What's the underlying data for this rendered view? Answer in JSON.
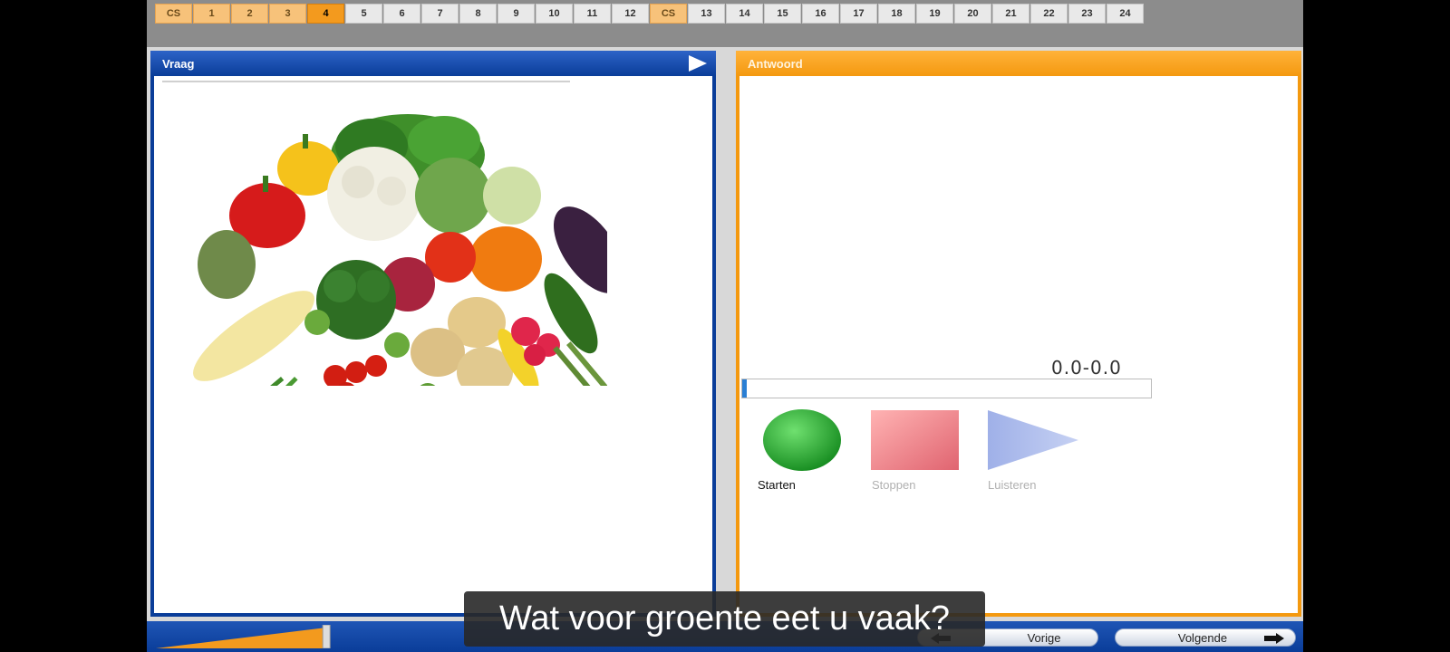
{
  "question_bar": {
    "items": [
      {
        "label": "CS",
        "state": "done"
      },
      {
        "label": "1",
        "state": "done"
      },
      {
        "label": "2",
        "state": "done"
      },
      {
        "label": "3",
        "state": "done"
      },
      {
        "label": "4",
        "state": "current"
      },
      {
        "label": "5",
        "state": "todo"
      },
      {
        "label": "6",
        "state": "todo"
      },
      {
        "label": "7",
        "state": "todo"
      },
      {
        "label": "8",
        "state": "todo"
      },
      {
        "label": "9",
        "state": "todo"
      },
      {
        "label": "10",
        "state": "todo"
      },
      {
        "label": "11",
        "state": "todo"
      },
      {
        "label": "12",
        "state": "todo"
      },
      {
        "label": "CS",
        "state": "done"
      },
      {
        "label": "13",
        "state": "todo"
      },
      {
        "label": "14",
        "state": "todo"
      },
      {
        "label": "15",
        "state": "todo"
      },
      {
        "label": "16",
        "state": "todo"
      },
      {
        "label": "17",
        "state": "todo"
      },
      {
        "label": "18",
        "state": "todo"
      },
      {
        "label": "19",
        "state": "todo"
      },
      {
        "label": "20",
        "state": "todo"
      },
      {
        "label": "21",
        "state": "todo"
      },
      {
        "label": "22",
        "state": "todo"
      },
      {
        "label": "23",
        "state": "todo"
      },
      {
        "label": "24",
        "state": "todo"
      }
    ]
  },
  "question_panel": {
    "title": "Vraag",
    "play_icon": "play-icon",
    "image": "vegetables-illustration"
  },
  "answer_panel": {
    "title": "Antwoord",
    "timer": "0.0-0.0",
    "recording_progress": 0.01,
    "controls": {
      "start_label": "Starten",
      "stop_label": "Stoppen",
      "listen_label": "Luisteren"
    }
  },
  "bottom_bar": {
    "volume_level": 0.96,
    "prev_label": "Vorige",
    "next_label": "Volgende"
  },
  "subtitle": "Wat voor groente eet u vaak?",
  "colors": {
    "question_blue": "#0a3d99",
    "answer_orange": "#f4990f",
    "current_question": "#f39a1e",
    "done_question": "#f7c27a"
  }
}
